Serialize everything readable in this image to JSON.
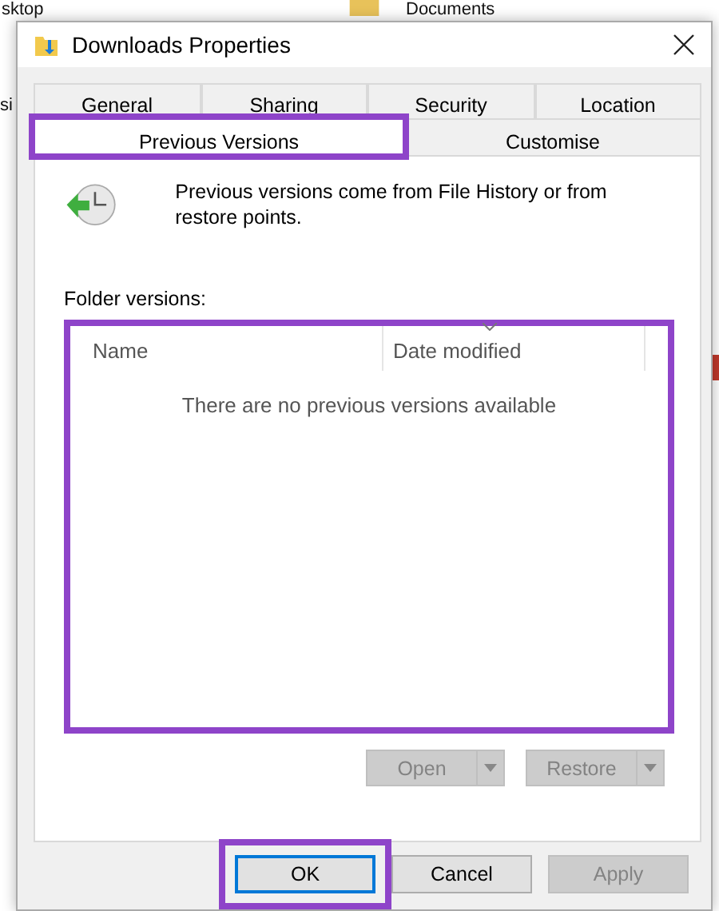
{
  "desktop": {
    "items": [
      "sktop",
      "Documents",
      "si"
    ]
  },
  "window": {
    "title": "Downloads Properties"
  },
  "tab_rows": [
    {
      "tabs": [
        {
          "label": "General",
          "selected": false,
          "highlighted": false
        },
        {
          "label": "Sharing",
          "selected": false,
          "highlighted": false
        },
        {
          "label": "Security",
          "selected": false,
          "highlighted": false
        },
        {
          "label": "Location",
          "selected": false,
          "highlighted": false
        }
      ]
    },
    {
      "tabs": [
        {
          "label": "Previous Versions",
          "selected": true,
          "highlighted": true
        },
        {
          "label": "Customise",
          "selected": false,
          "highlighted": false
        }
      ]
    }
  ],
  "info_text": "Previous versions come from File History or from restore points.",
  "folder_versions": {
    "label": "Folder versions:",
    "highlighted": true,
    "columns": [
      "Name",
      "Date modified"
    ],
    "empty_message": "There are no previous versions available"
  },
  "list_buttons": [
    {
      "label": "Open",
      "disabled": true
    },
    {
      "label": "Restore",
      "disabled": true
    }
  ],
  "buttons": [
    {
      "label": "OK",
      "disabled": false,
      "default": true,
      "highlighted": true
    },
    {
      "label": "Cancel",
      "disabled": false,
      "default": false,
      "highlighted": false
    },
    {
      "label": "Apply",
      "disabled": true,
      "default": false,
      "highlighted": false
    }
  ]
}
